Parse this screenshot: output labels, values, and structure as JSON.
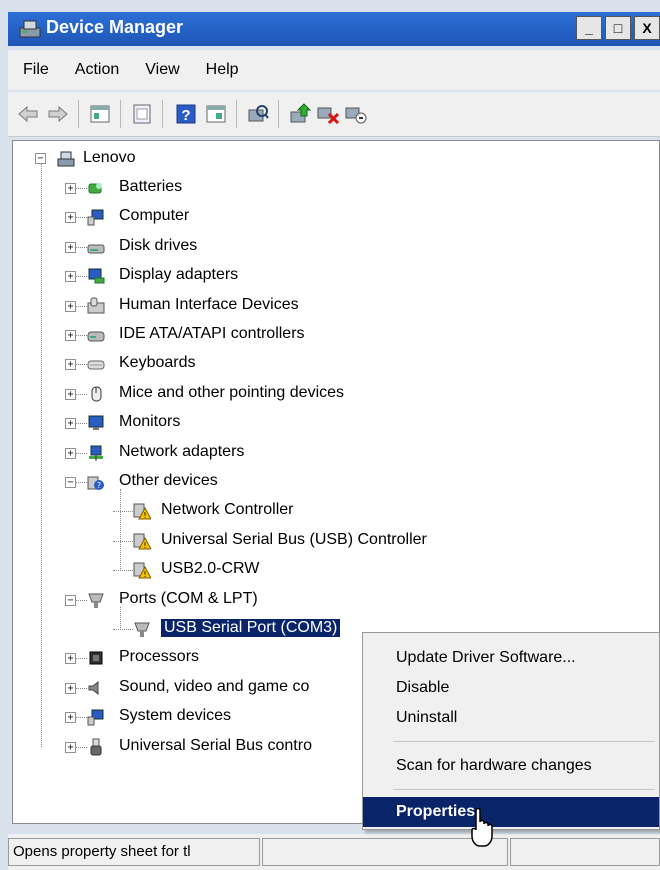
{
  "window": {
    "title": "Device Manager",
    "buttons": {
      "minimize": "_",
      "maximize": "□",
      "close": "X"
    }
  },
  "menubar": [
    "File",
    "Action",
    "View",
    "Help"
  ],
  "toolbar": [
    "back-arrow-icon",
    "forward-arrow-icon",
    "properties-sheet-icon",
    "window-icon",
    "help-icon",
    "details-icon",
    "scan-hardware-icon",
    "update-driver-icon",
    "uninstall-icon",
    "disable-icon"
  ],
  "tree": {
    "root": "Lenovo",
    "items": [
      {
        "label": "Batteries",
        "icon": "battery-icon",
        "expand": "+"
      },
      {
        "label": "Computer",
        "icon": "computer-icon",
        "expand": "+"
      },
      {
        "label": "Disk drives",
        "icon": "disk-icon",
        "expand": "+"
      },
      {
        "label": "Display adapters",
        "icon": "display-adapter-icon",
        "expand": "+"
      },
      {
        "label": "Human Interface Devices",
        "icon": "hid-icon",
        "expand": "+"
      },
      {
        "label": "IDE ATA/ATAPI controllers",
        "icon": "ide-icon",
        "expand": "+"
      },
      {
        "label": "Keyboards",
        "icon": "keyboard-icon",
        "expand": "+"
      },
      {
        "label": "Mice and other pointing devices",
        "icon": "mouse-icon",
        "expand": "+"
      },
      {
        "label": "Monitors",
        "icon": "monitor-icon",
        "expand": "+"
      },
      {
        "label": "Network adapters",
        "icon": "network-adapter-icon",
        "expand": "+"
      },
      {
        "label": "Other devices",
        "icon": "unknown-device-icon",
        "expand": "−"
      },
      {
        "label": "Network Controller",
        "icon": "warning-device-icon",
        "child": true
      },
      {
        "label": "Universal Serial Bus (USB) Controller",
        "icon": "warning-device-icon",
        "child": true
      },
      {
        "label": "USB2.0-CRW",
        "icon": "warning-device-icon",
        "child": true
      },
      {
        "label": "Ports (COM & LPT)",
        "icon": "port-icon",
        "expand": "−"
      },
      {
        "label": "USB Serial Port (COM3)",
        "icon": "port-icon",
        "child": true,
        "selected": true
      },
      {
        "label": "Processors",
        "icon": "processor-icon",
        "expand": "+"
      },
      {
        "label": "Sound, video and game co",
        "icon": "sound-icon",
        "expand": "+"
      },
      {
        "label": "System devices",
        "icon": "system-device-icon",
        "expand": "+"
      },
      {
        "label": "Universal Serial Bus contro",
        "icon": "usb-icon",
        "expand": "+"
      }
    ]
  },
  "context_menu": {
    "items": [
      "Update Driver Software...",
      "Disable",
      "Uninstall",
      "Scan for hardware changes",
      "Properties"
    ],
    "selected": "Properties"
  },
  "status": {
    "text": "Opens property sheet for tl"
  },
  "colors": {
    "selection": "#0a246a",
    "titlebar": "#2d6fd6",
    "menubar": "#f0f0f0"
  }
}
